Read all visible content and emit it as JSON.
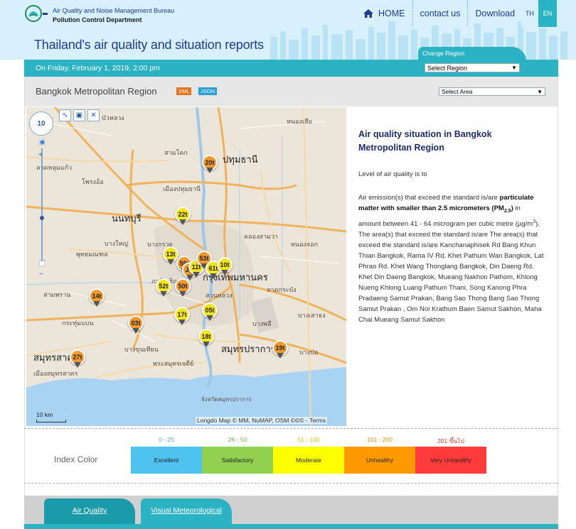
{
  "header": {
    "bureau": "Air Quality and Noise Management Bureau",
    "department": "Pollution Control Department",
    "site_title": "Thailand's air quality and situation reports",
    "nav": {
      "home": "HOME",
      "contact": "contact us",
      "download": "Download"
    },
    "lang": {
      "th": "TH",
      "en": "EN"
    },
    "change_region": "Change Region"
  },
  "date_bar": {
    "date_text": "On Friday, February 1, 2019, 2:00 pm",
    "region_select": "Select Region"
  },
  "region_bar": {
    "title": "Bangkok Metropolitan Region",
    "xml": "XML",
    "json": "JSON",
    "area_select": "Select Area"
  },
  "map": {
    "zoom_level": "10",
    "scale": "10 km",
    "attribution": "Longdo Map © MM, NuMAP, OSM ©©© - Terms",
    "labels": [
      {
        "text": "ปทุมธานี",
        "big": true
      },
      {
        "text": "นนทบุรี",
        "big": true
      },
      {
        "text": "กรุงเทพมหานคร",
        "big": true
      },
      {
        "text": "สมุทรปราการ",
        "big": true
      },
      {
        "text": "สมุทรสาคร",
        "big": true
      },
      {
        "text": "บัวหลวง"
      },
      {
        "text": "หนองเสือ"
      },
      {
        "text": "สามโคก"
      },
      {
        "text": "โพรงอ้อ"
      },
      {
        "text": "เมืองปทุมธานี"
      },
      {
        "text": "ลาดหลุมแก้ว"
      },
      {
        "text": "บางใหญ่"
      },
      {
        "text": "บางกรวย"
      },
      {
        "text": "พุทธมณฑล"
      },
      {
        "text": "สามพราน"
      },
      {
        "text": "กระทุ่มแบน"
      },
      {
        "text": "คลองสามวา"
      },
      {
        "text": "หนองจอก"
      },
      {
        "text": "ลาดกระบัง"
      },
      {
        "text": "บางพลี"
      },
      {
        "text": "บางบ่อ"
      },
      {
        "text": "บางขุนเทียน"
      },
      {
        "text": "พระสมุทรเจดีย์"
      },
      {
        "text": "เมืองสมุทรสาคร"
      },
      {
        "text": "จังหวัดสมุทรปราการ"
      },
      {
        "text": "ภาษีเจริญ"
      },
      {
        "text": "สวนหลวง"
      },
      {
        "text": "บางเสาธง"
      }
    ],
    "markers": [
      {
        "label": "20t",
        "level": "unhealthy"
      },
      {
        "label": "22t",
        "level": "moderate"
      },
      {
        "label": "13t",
        "level": "moderate"
      },
      {
        "label": "59t",
        "level": "unhealthy"
      },
      {
        "label": "11t",
        "level": "moderate"
      },
      {
        "label": "53t",
        "level": "unhealthy"
      },
      {
        "label": "61t",
        "level": "moderate"
      },
      {
        "label": "10t",
        "level": "moderate"
      },
      {
        "label": "14t",
        "level": "unhealthy"
      },
      {
        "label": "52t",
        "level": "moderate"
      },
      {
        "label": "50t",
        "level": "unhealthy"
      },
      {
        "label": "17t",
        "level": "moderate"
      },
      {
        "label": "05t",
        "level": "moderate"
      },
      {
        "label": "03t",
        "level": "unhealthy"
      },
      {
        "label": "18t",
        "level": "moderate"
      },
      {
        "label": "19t",
        "level": "unhealthy"
      },
      {
        "label": "27t",
        "level": "unhealthy"
      },
      {
        "label": "J4t",
        "level": "unhealthy"
      }
    ]
  },
  "info": {
    "title": "Air quality situation in Bangkok Metropolitan Region",
    "level_text": "Level of air quality is to",
    "p1_prefix": "Air emission(s) that exceed the standard is/are ",
    "p1_bold": "particulate matter with smaller than 2.5 micrometers (PM",
    "p1_sub": "2.5",
    "p1_bold_end": ")",
    "p1_mid": " in amount between 41 - 64 microgram per cubic metre (µg/m",
    "p1_sup": "3",
    "p1_end": "). The area(s) that exceed the standard is/are The area(s) that exceed the standard is/are Kanchanaphisek Rd Bang Khun Thian Bangkok, Rama IV Rd. Khet Pathum Wan Bangkok, Lat Phrao Rd. Khet Wang Thonglang Bangkok, Din Daeng Rd. Khet Din Daeng Bangkok, Mueang Nakhon Pathom, Khlong Nueng Khlong Luang Pathum Thani, Song Kanong Phra Pradaeng Samut Prakan, Bang Sao Thong Bang Sao Thong Samut Prakan , Om Noi Krathum Baen Samut Sakhon, Maha Chai Mueang Samut Sakhon"
  },
  "legend": {
    "label": "Index Color",
    "items": [
      {
        "range": "0 - 25",
        "name": "Excellent",
        "color": "#4fc3f0",
        "range_color": "#4fa8e0"
      },
      {
        "range": "26 - 50",
        "name": "Satisfactory",
        "color": "#92d050",
        "range_color": "#7cb342"
      },
      {
        "range": "51 - 100",
        "name": "Moderate",
        "color": "#ffff00",
        "range_color": "#d9c400"
      },
      {
        "range": "101 - 200",
        "name": "Unhealthy",
        "color": "#ff9900",
        "range_color": "#f08c00"
      },
      {
        "range": "201 ขึ้นไป",
        "name": "Very Unhealthy",
        "color": "#ff3b3b",
        "range_color": "#e53935"
      }
    ]
  },
  "tabs": {
    "air_quality": "Air Quality",
    "visual_met": "Visual Meteorological"
  },
  "colors": {
    "teal": "#2bb3c4",
    "navy": "#1e3c96",
    "moderate": "#f4e41c",
    "unhealthy": "#f39a2d"
  }
}
